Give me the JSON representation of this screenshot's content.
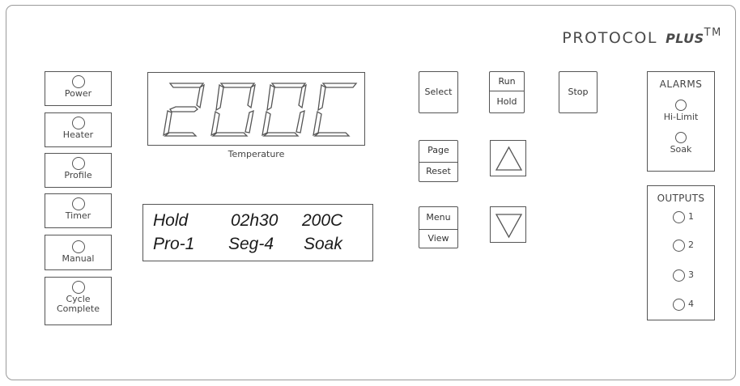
{
  "brand": {
    "name": "PROTOCOL",
    "plus": "PLUS",
    "tm": "TM"
  },
  "indicators": [
    {
      "label": "Power"
    },
    {
      "label": "Heater"
    },
    {
      "label": "Profile"
    },
    {
      "label": "Timer"
    },
    {
      "label": "Manual"
    },
    {
      "label": "Cycle",
      "label2": "Complete"
    }
  ],
  "temperature_display": {
    "value": "200C",
    "label": "Temperature"
  },
  "lcd": {
    "row1": [
      "Hold",
      "02h30",
      "200C"
    ],
    "row2": [
      "Pro-1",
      "Seg-4",
      "Soak"
    ]
  },
  "buttons": {
    "select": "Select",
    "run": "Run",
    "hold": "Hold",
    "stop": "Stop",
    "page": "Page",
    "reset": "Reset",
    "menu": "Menu",
    "view": "View",
    "up_icon": "up-arrow-icon",
    "down_icon": "down-arrow-icon"
  },
  "alarms": {
    "title": "ALARMS",
    "items": [
      "Hi-Limit",
      "Soak"
    ]
  },
  "outputs": {
    "title": "OUTPUTS",
    "items": [
      "1",
      "2",
      "3",
      "4"
    ]
  },
  "colors": {
    "line": "#555555",
    "panel_border": "#9a9a9a",
    "text": "#333333"
  }
}
